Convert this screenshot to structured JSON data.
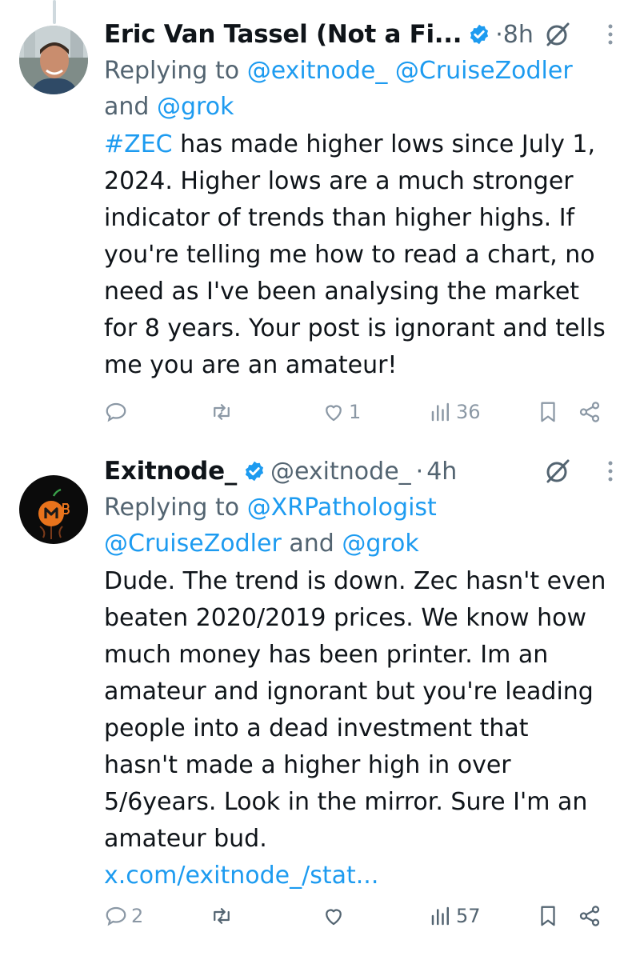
{
  "tweets": [
    {
      "author_name": "Eric Van Tassel (Not a Fi...",
      "time_sep": "·",
      "time": "8h",
      "reply_prefix": "Replying to",
      "reply_mentions": [
        "@exitnode_",
        "@CruiseZodler"
      ],
      "reply_and": "and",
      "reply_last": "@grok",
      "hashtag": "#ZEC",
      "body": [
        " has made higher lows since July 1,",
        "2024. Higher lows are a much stronger",
        "indicator of trends than higher highs. If",
        "you're telling me how to read a chart, no",
        "need as I've been analysing the market",
        "for 8 years. Your post is ignorant and tells",
        "me you are an amateur!"
      ],
      "stats": {
        "replies": "",
        "reposts": "",
        "likes": "1",
        "views": "36"
      }
    },
    {
      "author_name": "Exitnode_",
      "handle": "@exitnode_",
      "time_sep": "·",
      "time": "4h",
      "reply_prefix": "Replying to",
      "reply_mentions": [
        "@XRPathologist",
        "@CruiseZodler"
      ],
      "reply_and": "and",
      "reply_last": "@grok",
      "body": [
        "Dude. The trend is down. Zec hasn't even",
        "beaten 2020/2019 prices. We know how",
        "much money has been printer. Im an",
        "amateur and ignorant but you're leading",
        "people into a dead investment that",
        "hasn't made a higher high in over",
        "5/6years. Look in the mirror. Sure I'm an",
        "amateur bud."
      ],
      "link": "x.com/exitnode_/stat...",
      "stats": {
        "replies": "2",
        "reposts": "",
        "likes": "",
        "views": "57"
      }
    }
  ],
  "icons": {
    "verified": "verified-badge-icon",
    "grok": "grok-icon",
    "more": "more-vertical-icon",
    "reply": "reply-icon",
    "repost": "repost-icon",
    "like": "heart-icon",
    "views": "views-icon",
    "bookmark": "bookmark-icon",
    "share": "share-icon"
  },
  "colors": {
    "accent": "#1d9bf0",
    "text": "#0f1419",
    "muted": "#536471",
    "action": "#8b98a5"
  }
}
